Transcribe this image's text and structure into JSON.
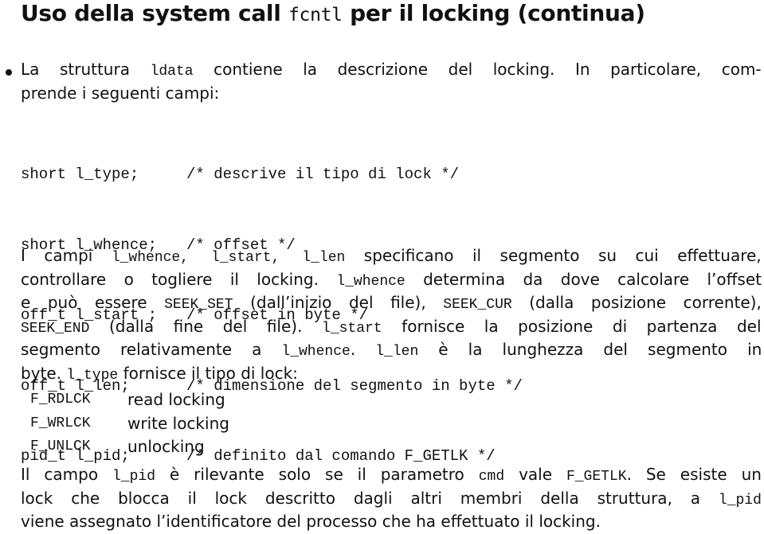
{
  "title": {
    "pre": "Uso della system call ",
    "code": "fcntl",
    "post": " per il locking (continua)"
  },
  "intro": {
    "line1": {
      "pre": "La struttura ",
      "code": "ldata",
      "post": " contiene la descrizione del locking. In particolare, com-"
    },
    "line2": "prende i seguenti campi:"
  },
  "struct_fields": [
    {
      "decl": "short l_type;",
      "comment": "/* descrive il tipo di lock */"
    },
    {
      "decl": "short l_whence;",
      "comment": "/* offset */"
    },
    {
      "decl": "off_t l_start ;",
      "comment": "/* offset in byte */"
    },
    {
      "decl": "off_t l_len;",
      "comment": "/* dimensione del segmento in byte */"
    },
    {
      "decl": "pid_t l_pid;",
      "comment": "/* definito dal comando F_GETLK */"
    }
  ],
  "paragraph1": {
    "l1": {
      "t1": "I campi ",
      "c1": "l_whence",
      "t2": ", ",
      "c2": "l_start",
      "t3": ", ",
      "c3": "l_len",
      "t4": " specificano il segmento su cui effettuare,"
    },
    "l2": {
      "t1": "controllare o togliere il locking. ",
      "c1": "l_whence",
      "t2": " determina da dove calcolare l’offset"
    },
    "l3": {
      "t1": "e può essere ",
      "c1": "SEEK_SET",
      "t2": " (dall’inizio del file), ",
      "c2": "SEEK_CUR",
      "t3": " (dalla posizione corrente),"
    },
    "l4": {
      "c1": "SEEK_END",
      "t1": " (dalla fine del file). ",
      "c2": "l_start",
      "t2": " fornisce la posizione di partenza del"
    },
    "l5": {
      "t1": "segmento relativamente a ",
      "c1": "l_whence",
      "t2": ". ",
      "c2": "l_len",
      "t3": " è la lunghezza del segmento in"
    },
    "l6": {
      "t1": "byte. ",
      "c1": "l_type",
      "t2": " fornisce il tipo di lock:"
    }
  },
  "lock_types": [
    {
      "constant": "F_RDLCK",
      "description": "read locking"
    },
    {
      "constant": "F_WRLCK",
      "description": "write locking"
    },
    {
      "constant": "F_UNLCK",
      "description": "unlocking"
    }
  ],
  "paragraph2": {
    "l1": {
      "t1": "Il campo ",
      "c1": "l_pid",
      "t2": " è rilevante solo se il parametro ",
      "c2": "cmd",
      "t3": " vale ",
      "c3": "F_GETLK",
      "t4": ". Se esiste un"
    },
    "l2": {
      "t1": "lock che blocca il lock descritto dagli altri membri della struttura, a ",
      "c1": "l_pid"
    },
    "l3": "viene assegnato l’identificatore del processo che ha effettuato il locking."
  }
}
